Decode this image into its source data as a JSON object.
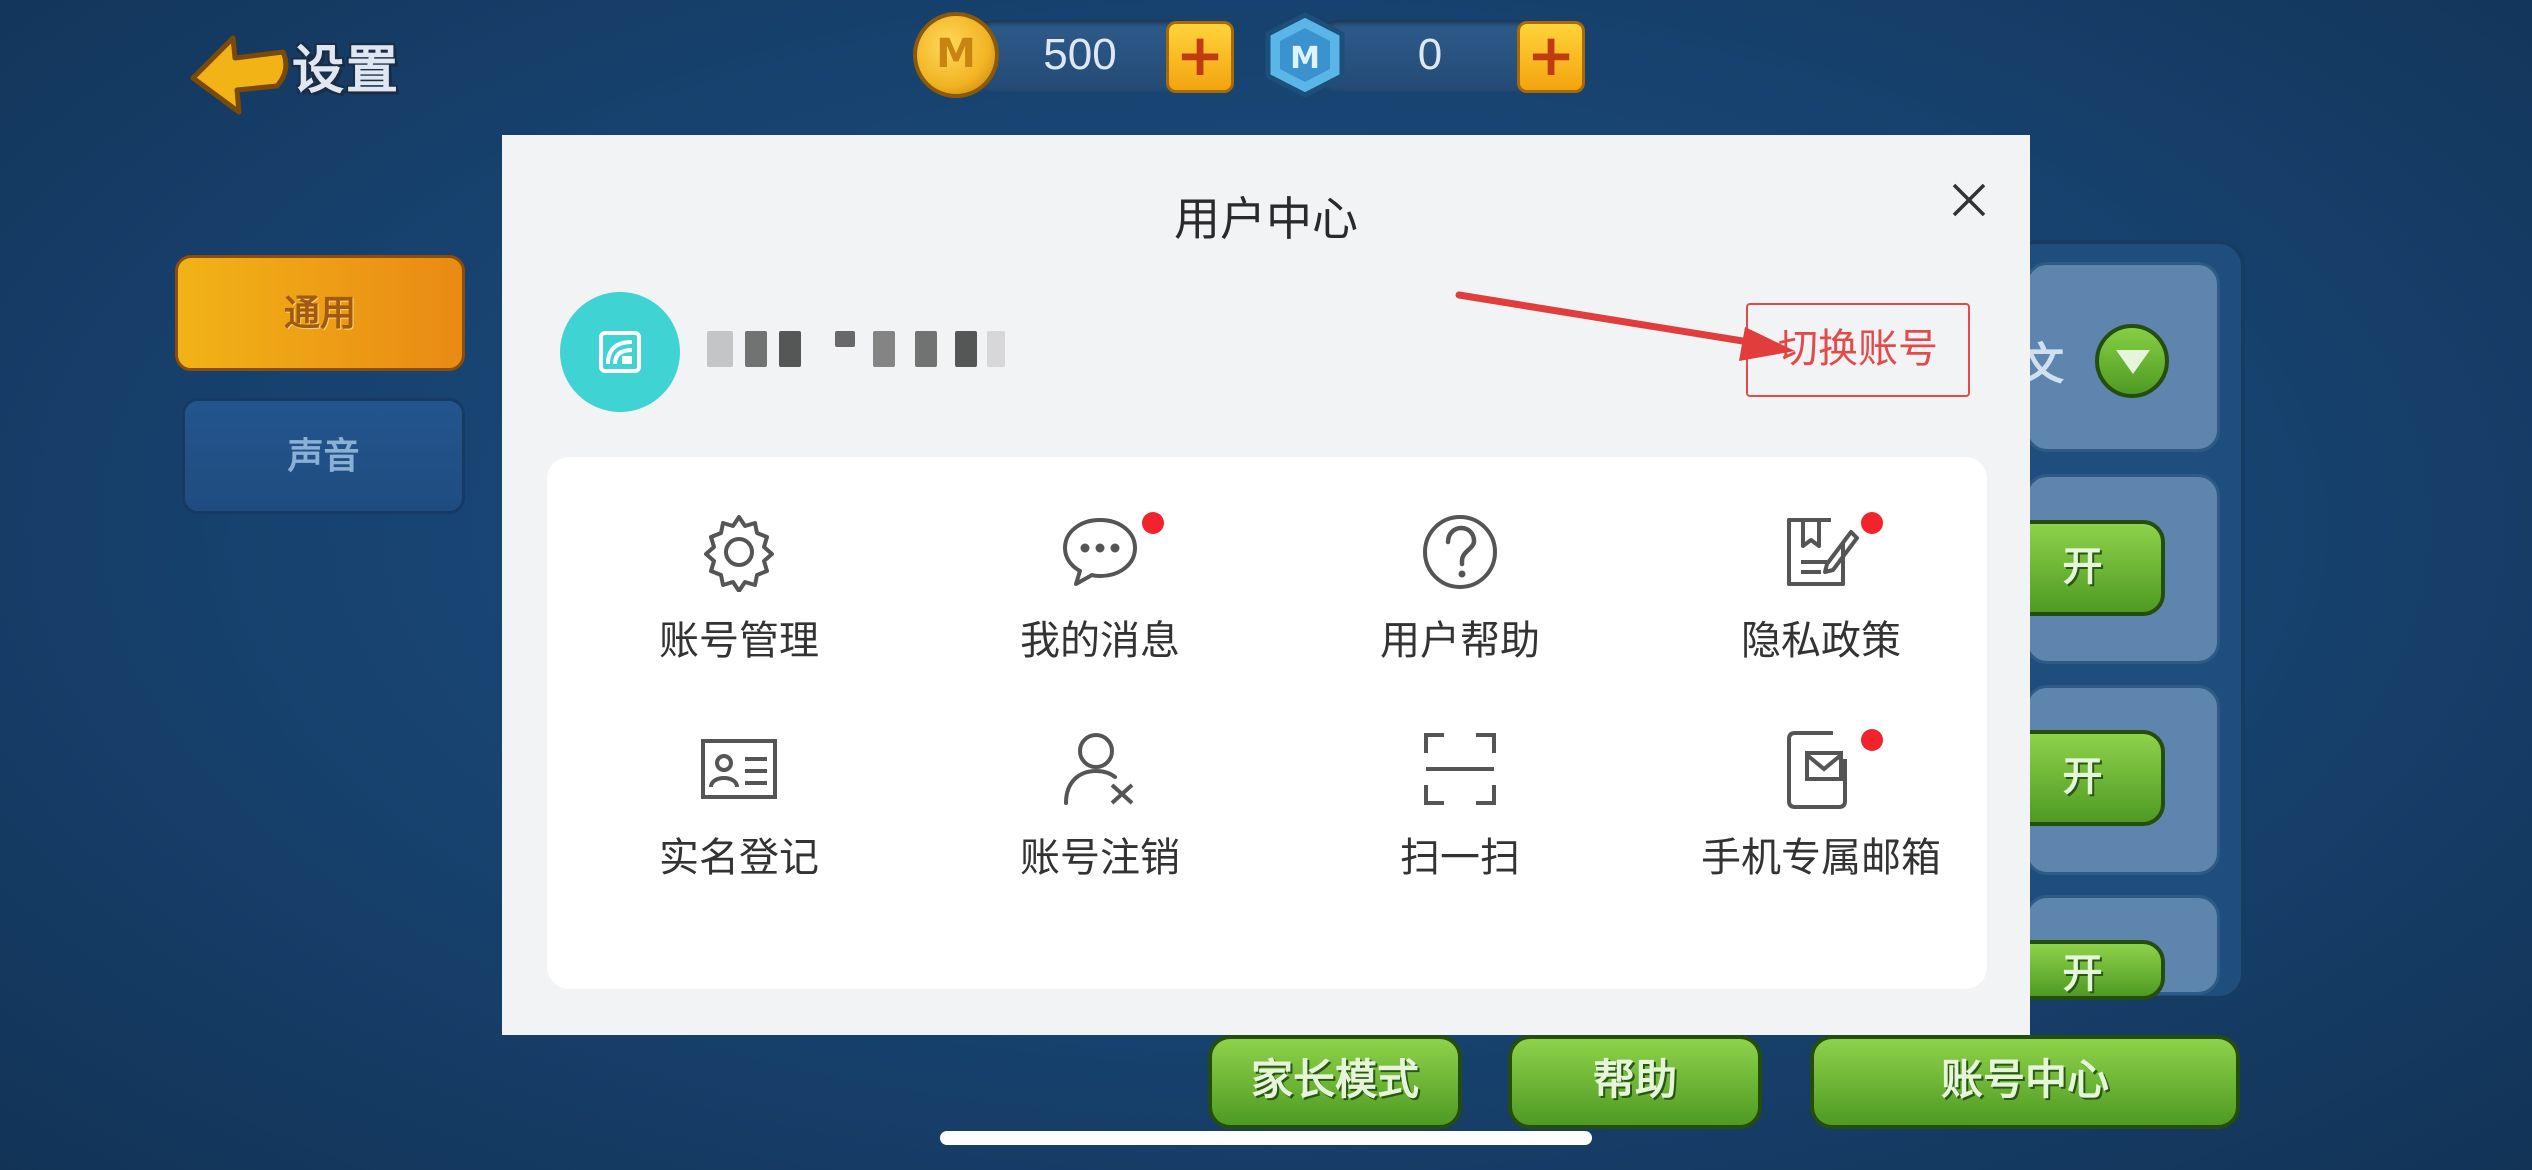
{
  "game": {
    "title": "设置",
    "coins": "500",
    "coin_symbol": "M",
    "gems": "0",
    "gem_symbol": "M",
    "plus": "+",
    "tabs": [
      {
        "label": "通用",
        "selected": true
      },
      {
        "label": "声音",
        "selected": false
      }
    ],
    "right_partial": [
      {
        "text": "文"
      },
      {
        "text": "开"
      },
      {
        "text": "开"
      },
      {
        "text": "开"
      }
    ],
    "bottom_buttons": [
      {
        "label": "家长模式"
      },
      {
        "label": "帮助"
      },
      {
        "label": "账号中心"
      }
    ]
  },
  "modal": {
    "title": "用户中心",
    "switch_account": "切换账号",
    "items": [
      {
        "label": "账号管理",
        "icon": "gear-icon",
        "badge": false
      },
      {
        "label": "我的消息",
        "icon": "chat-bubble-icon",
        "badge": true
      },
      {
        "label": "用户帮助",
        "icon": "question-circle-icon",
        "badge": false
      },
      {
        "label": "隐私政策",
        "icon": "document-edit-icon",
        "badge": true
      },
      {
        "label": "实名登记",
        "icon": "id-card-icon",
        "badge": false
      },
      {
        "label": "账号注销",
        "icon": "user-remove-icon",
        "badge": false
      },
      {
        "label": "扫一扫",
        "icon": "scan-icon",
        "badge": false
      },
      {
        "label": "手机专属邮箱",
        "icon": "phone-mail-icon",
        "badge": true
      }
    ]
  },
  "colors": {
    "accent_red": "#e24b4b",
    "badge_red": "#f2232d",
    "avatar": "#3fd3d3",
    "game_green": "#6bb534",
    "game_orange": "#f2b317"
  }
}
